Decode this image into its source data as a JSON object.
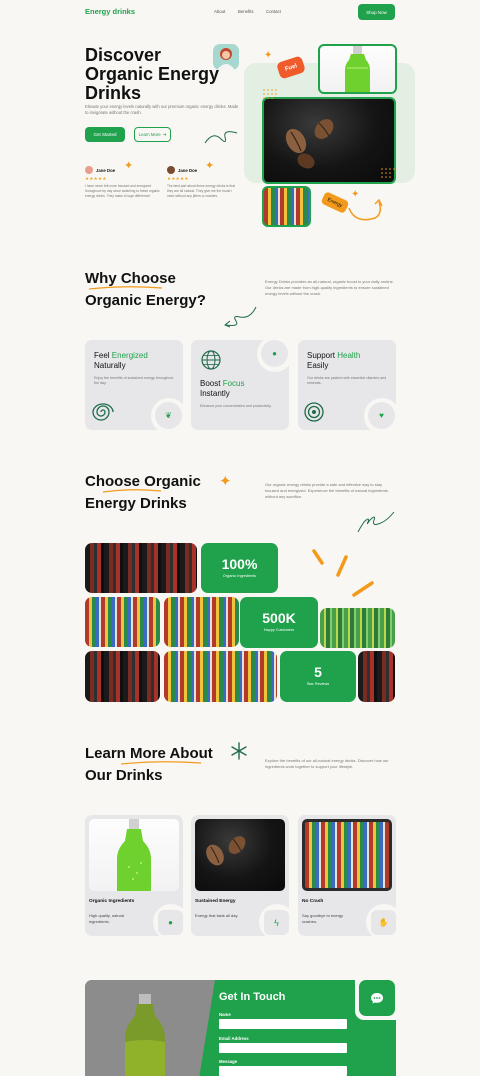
{
  "nav": {
    "brand": "Energy drinks",
    "links": [
      "About",
      "Benefits",
      "Contact"
    ],
    "cta": "Shop Now"
  },
  "hero": {
    "title_l1": "Discover",
    "title_l2": "Organic Energy",
    "title_l3": "Drinks",
    "subtitle": "Elevate your energy levels naturally with our premium organic energy drinks. Made to invigorate without the crash.",
    "primary_btn": "Get Started",
    "secondary_btn": "Learn More",
    "tag_fuel": "Fuel",
    "tag_energy": "Energy",
    "reviews": [
      {
        "name": "Jane Doe",
        "stars": "★★★★★",
        "text": "I have never felt more focused and energized throughout my day since switching to these organic energy drinks. They make a huge difference!"
      },
      {
        "name": "Jane Doe",
        "stars": "★★★★★",
        "text": "The best part about these energy drinks is that they are all natural. They give me the boost I need without any jitters or crashes."
      }
    ]
  },
  "why": {
    "title_l1": "Why Choose",
    "title_l2": "Organic Energy?",
    "desc": "Energy Drinks provides an all-natural, organic boost to your daily routine. Our drinks are made from high-quality ingredients to ensure sustained energy levels without the crash.",
    "features": [
      {
        "pre": "Feel ",
        "hl": "Energized",
        "post": "Naturally",
        "desc": "Enjoy the benefits of sustained energy throughout the day."
      },
      {
        "pre": "Boost ",
        "hl": "Focus",
        "post": "Instantly",
        "desc": "Enhance your concentration and productivity."
      },
      {
        "pre": "Support ",
        "hl": "Health",
        "post": "Easily",
        "desc": "Our drinks are packed with essential vitamins and minerals."
      }
    ]
  },
  "choose": {
    "title_l1": "Choose Organic",
    "title_l2": "Energy Drinks",
    "desc": "Our organic energy drinks provide a safe and effective way to stay focused and energized. Experience the benefits of natural ingredients without any sacrifice.",
    "stats": [
      {
        "value": "100%",
        "label": "Organic Ingredients"
      },
      {
        "value": "500K",
        "label": "Happy Customers"
      },
      {
        "value": "5",
        "label": "Star Reviews"
      }
    ]
  },
  "learn": {
    "title_l1": "Learn More About",
    "title_l2": "Our Drinks",
    "desc": "Explore the benefits of our all-natural energy drinks. Discover how our ingredients work together to support your lifestyle.",
    "cards": [
      {
        "title": "Organic Ingredients",
        "desc": "High quality, natural ingredients."
      },
      {
        "title": "Sustained Energy",
        "desc": "Energy that lasts all day."
      },
      {
        "title": "No Crash",
        "desc": "Say goodbye to energy crashes."
      }
    ]
  },
  "contact": {
    "title": "Get In Touch",
    "name_label": "Name",
    "email_label": "Email Address",
    "message_label": "Message"
  },
  "colors": {
    "accent": "#1fa24b",
    "orange": "#f39a1d",
    "background": "#f8f7f3",
    "card": "#e7e7ea"
  }
}
